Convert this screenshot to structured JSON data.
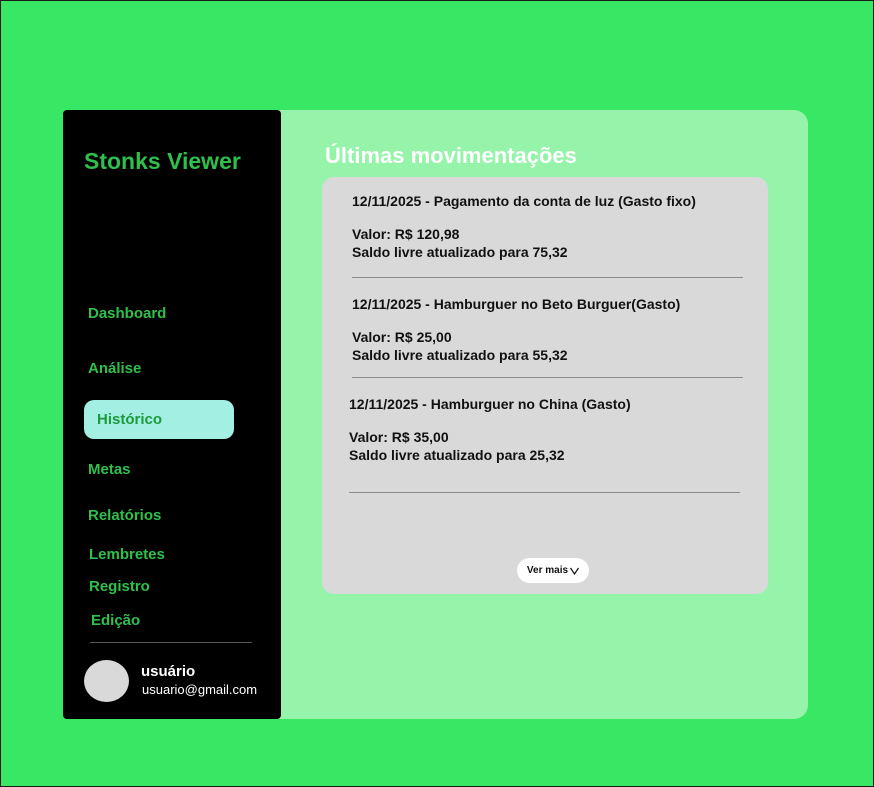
{
  "brand": "Stonks Viewer",
  "nav": [
    {
      "label": "Dashboard",
      "active": false
    },
    {
      "label": "Análise",
      "active": false
    },
    {
      "label": "Histórico",
      "active": true
    },
    {
      "label": "Metas",
      "active": false
    },
    {
      "label": "Relatórios",
      "active": false
    },
    {
      "label": "Lembretes",
      "active": false
    },
    {
      "label": "Registro",
      "active": false
    },
    {
      "label": "Edição",
      "active": false
    }
  ],
  "user": {
    "name": "usuário",
    "email": "usuario@gmail.com"
  },
  "main": {
    "title": "Últimas movimentações",
    "transactions": [
      {
        "header": "12/11/2025 -  Pagamento da conta de luz (Gasto fixo)",
        "value": "Valor: R$ 120,98",
        "balance": "Saldo livre atualizado para 75,32"
      },
      {
        "header": "12/11/2025 -  Hamburguer no Beto Burguer(Gasto)",
        "value": "Valor: R$ 25,00",
        "balance": "Saldo livre atualizado para 55,32"
      },
      {
        "header": "12/11/2025 -  Hamburguer no China (Gasto)",
        "value": "Valor: R$ 35,00",
        "balance": "Saldo livre atualizado para 25,32"
      }
    ],
    "more_label": "Ver mais",
    "more_icon": "chevron-down-icon"
  },
  "colors": {
    "page_bg": "#38e865",
    "panel_bg": "#96f4aa",
    "sidebar_bg": "#000000",
    "accent_green": "#2fc04c",
    "active_item_bg": "#a3efe3",
    "card_bg": "#d9d9d9"
  }
}
